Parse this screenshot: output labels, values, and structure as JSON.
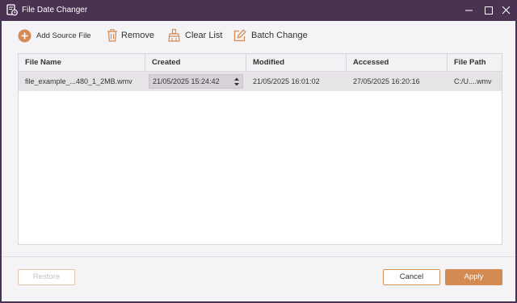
{
  "window": {
    "title": "File Date Changer"
  },
  "colors": {
    "accent": "#d38b53",
    "titlebar": "#4a3352",
    "row_selected": "#e7e4e8"
  },
  "toolbar": {
    "add_label": "Add Source File",
    "remove_label": "Remove",
    "clear_label": "Clear List",
    "batch_label": "Batch Change"
  },
  "table": {
    "columns": [
      "File Name",
      "Created",
      "Modified",
      "Accessed",
      "File Path"
    ],
    "rows": [
      {
        "file_name": "file_example_...480_1_2MB.wmv",
        "created": "21/05/2025 15:24:42",
        "modified": "21/05/2025 16:01:02",
        "accessed": "27/05/2025 16:20:16",
        "file_path": "C:/U....wmv"
      }
    ]
  },
  "footer": {
    "restore_label": "Restore",
    "cancel_label": "Cancel",
    "apply_label": "Apply"
  }
}
